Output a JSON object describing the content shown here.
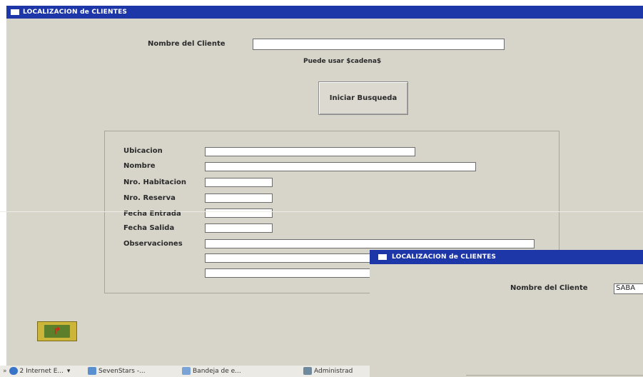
{
  "main_window": {
    "title": "LOCALIZACION de CLIENTES",
    "search_label": "Nombre del Cliente",
    "search_value": "",
    "hint": "Puede usar  $cadena$",
    "search_button": "Iniciar Busqueda",
    "fields": {
      "ubicacion": "Ubicacion",
      "nombre": "Nombre",
      "nro_habitacion": "Nro. Habitacion",
      "nro_reserva": "Nro. Reserva",
      "fecha_entrada": "Fecha Entrada",
      "fecha_salida": "Fecha Salida",
      "observaciones": "Observaciones"
    },
    "exit_button_icon": "exit-door-icon"
  },
  "overlay_window": {
    "title": "LOCALIZACION de CLIENTES",
    "search_label": "Nombre del Cliente",
    "search_value": "SABA"
  },
  "taskbar": {
    "items": [
      "2 Internet E...",
      "SevenStars -...",
      "Bandeja de e...",
      "Administrad"
    ]
  },
  "colors": {
    "titlebar": "#1d36a8",
    "window_bg": "#d7d4ca",
    "exit_button": "#cdb53a"
  }
}
